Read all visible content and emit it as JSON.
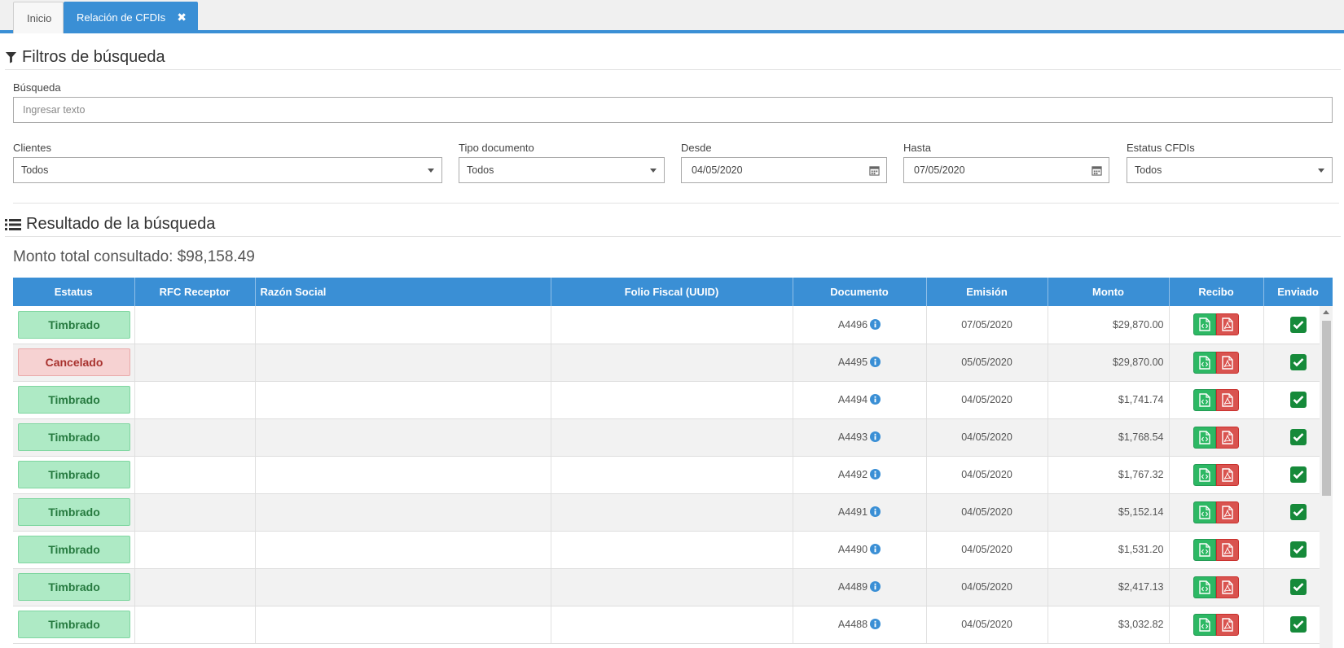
{
  "tabs": [
    {
      "label": "Inicio"
    },
    {
      "label": "Relación de CFDIs",
      "close": "✖"
    }
  ],
  "filters": {
    "title": "Filtros de búsqueda",
    "search_label": "Búsqueda",
    "search_placeholder": "Ingresar texto",
    "clientes_label": "Clientes",
    "clientes_value": "Todos",
    "tipo_label": "Tipo documento",
    "tipo_value": "Todos",
    "desde_label": "Desde",
    "desde_value": "04/05/2020",
    "hasta_label": "Hasta",
    "hasta_value": "07/05/2020",
    "estatus_label": "Estatus CFDIs",
    "estatus_value": "Todos"
  },
  "results": {
    "title": "Resultado de la búsqueda",
    "total": "Monto total consultado: $98,158.49",
    "columns": [
      "Estatus",
      "RFC Receptor",
      "Razón Social",
      "Folio Fiscal (UUID)",
      "Documento",
      "Emisión",
      "Monto",
      "Recibo",
      "Enviado"
    ],
    "rows": [
      {
        "status": "Timbrado",
        "doc": "A4496",
        "date": "07/05/2020",
        "amount": "$29,870.00"
      },
      {
        "status": "Cancelado",
        "doc": "A4495",
        "date": "05/05/2020",
        "amount": "$29,870.00"
      },
      {
        "status": "Timbrado",
        "doc": "A4494",
        "date": "04/05/2020",
        "amount": "$1,741.74"
      },
      {
        "status": "Timbrado",
        "doc": "A4493",
        "date": "04/05/2020",
        "amount": "$1,768.54"
      },
      {
        "status": "Timbrado",
        "doc": "A4492",
        "date": "04/05/2020",
        "amount": "$1,767.32"
      },
      {
        "status": "Timbrado",
        "doc": "A4491",
        "date": "04/05/2020",
        "amount": "$5,152.14"
      },
      {
        "status": "Timbrado",
        "doc": "A4490",
        "date": "04/05/2020",
        "amount": "$1,531.20"
      },
      {
        "status": "Timbrado",
        "doc": "A4489",
        "date": "04/05/2020",
        "amount": "$2,417.13"
      },
      {
        "status": "Timbrado",
        "doc": "A4488",
        "date": "04/05/2020",
        "amount": "$3,032.82"
      }
    ]
  },
  "colors": {
    "accent": "#3a8fd5",
    "ok": "#aeeac5",
    "cancel": "#f6d2d2",
    "xml": "#2db864",
    "pdf": "#d9534f",
    "check": "#168a3a"
  },
  "icons": {
    "filter": "filter-icon",
    "list": "list-icon",
    "calendar": "calendar-icon",
    "info": "info-icon",
    "xml": "file-code-icon",
    "pdf": "file-pdf-icon",
    "check": "checkbox-checked-icon"
  }
}
